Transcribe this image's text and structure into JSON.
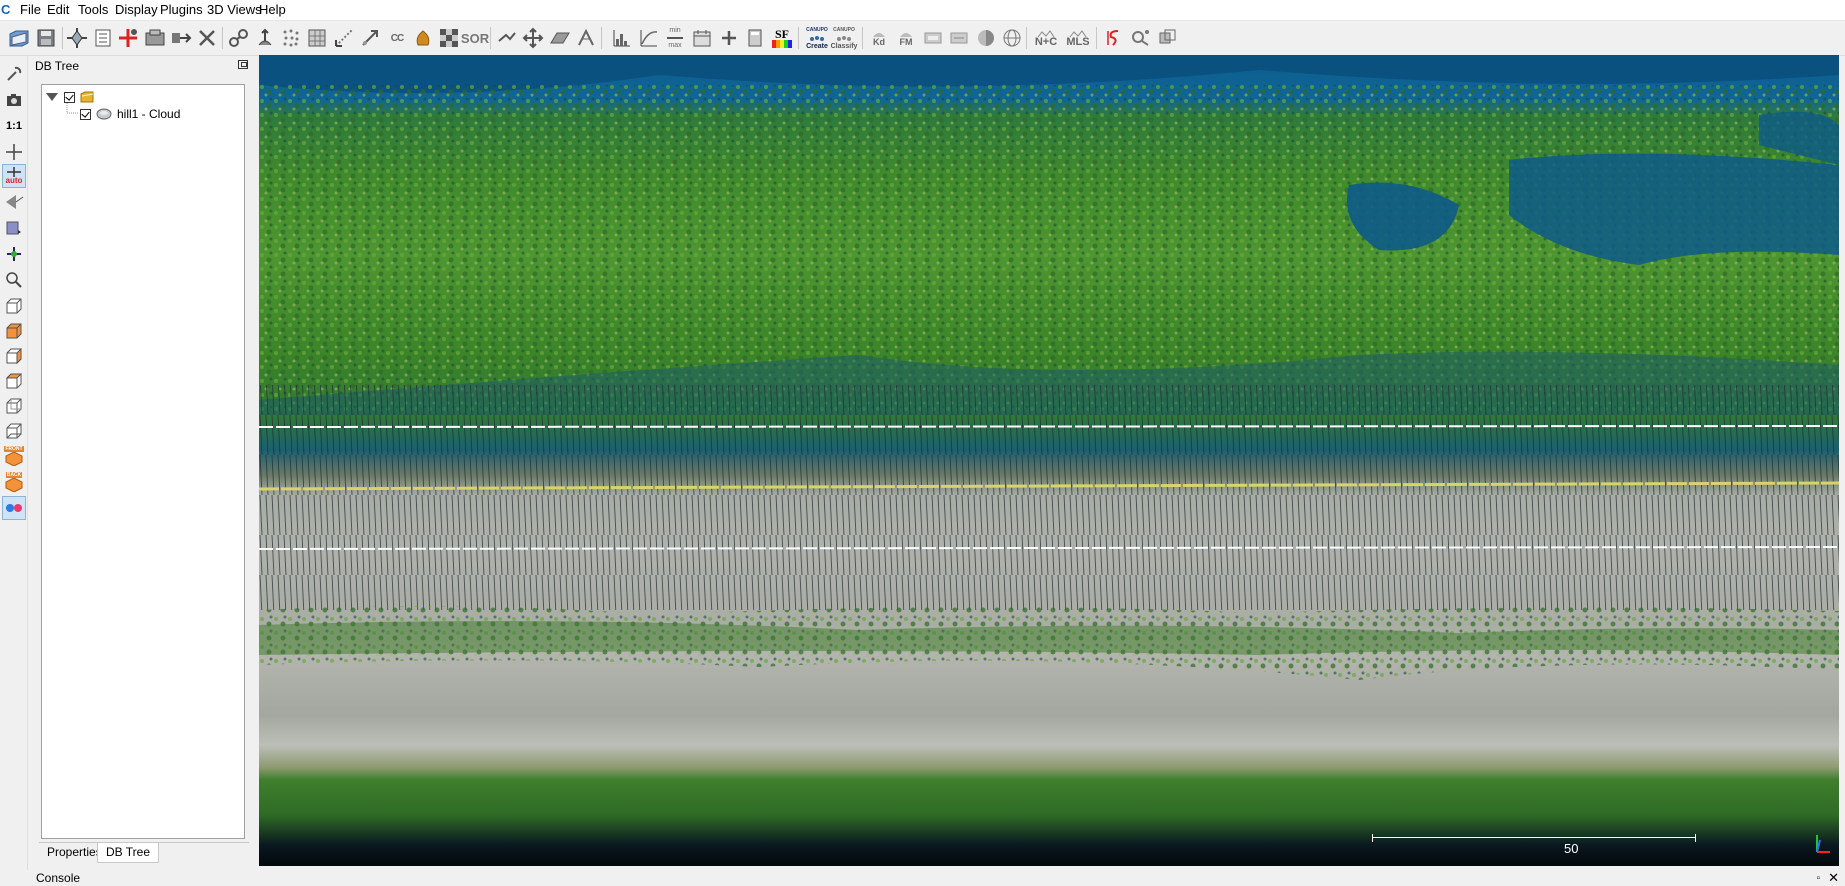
{
  "app": {
    "icon_glyph": "C"
  },
  "menu": [
    "File",
    "Edit",
    "Tools",
    "Display",
    "Plugins",
    "3D Views",
    "Help"
  ],
  "toolbar": {
    "icons": [
      "open-icon",
      "save-icon",
      "translate-rotate-icon",
      "list-icon",
      "clone-icon",
      "sample-icon",
      "merge-icon",
      "delete-icon",
      "subsample-icon",
      "normals-icon",
      "octree-icon",
      "mesh-icon",
      "distance-icon",
      "registration-icon",
      "cc-icon",
      "color-icon",
      "checker-icon",
      "sor-icon",
      "segment-icon",
      "move-icon",
      "plane-icon",
      "measure-icon",
      "histogram-icon",
      "fit-icon",
      "minmax-icon",
      "calendar-icon",
      "plus-icon",
      "calculator-icon",
      "sf-icon",
      "canupo-create-icon",
      "canupo-classify-icon",
      "kd-icon",
      "fm-icon",
      "plugin1-icon",
      "plugin2-icon",
      "sphere-icon",
      "globe-icon",
      "nc-icon",
      "mls-icon",
      "s-icon",
      "qualified-icon",
      "hpr-icon"
    ],
    "labels": {
      "cc": "CC",
      "sor": "SOR",
      "sf": "SF",
      "canupo_create_top": "CANUPO",
      "canupo_create": "Create",
      "canupo_classify_top": "CANUPO",
      "canupo_classify": "Classify",
      "kd": "Kd",
      "fm": "FM",
      "nc": "N+C",
      "mls": "MLS",
      "minmax_top": "min",
      "minmax_bottom": "max"
    }
  },
  "left_toolbar": {
    "icons": [
      "wrench-icon",
      "camera-icon",
      "one-to-one-icon",
      "crosshair-icon",
      "auto-pivot-icon",
      "point-picking-icon",
      "perspective-icon",
      "move-pivot-icon",
      "zoom-icon",
      "top-view-icon",
      "front-view-icon",
      "left-view-icon",
      "back-view-icon",
      "right-view-icon",
      "bottom-view-icon",
      "iso-front-icon",
      "iso-back-icon",
      "stereo-icon"
    ],
    "labels": {
      "one_to_one": "1:1",
      "auto": "auto",
      "front": "FRONT",
      "back": "BACK"
    }
  },
  "db_tree": {
    "title": "DB Tree",
    "items": [
      {
        "label": "",
        "checked": true,
        "expanded": true
      },
      {
        "label": "hill1 - Cloud",
        "checked": true
      }
    ],
    "tabs": [
      "Properties",
      "DB Tree"
    ],
    "active_tab": "DB Tree"
  },
  "view": {
    "scale_label": "50",
    "axis_colors": {
      "x": "#ff2020",
      "y": "#20c040",
      "z": "#3070ff"
    }
  },
  "console": {
    "title": "Console",
    "float_glyph": "▫",
    "close_glyph": "✕"
  }
}
